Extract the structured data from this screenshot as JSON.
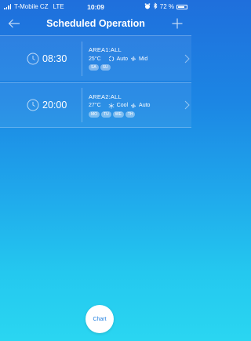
{
  "status_bar": {
    "carrier": "T-Mobile CZ",
    "network": "LTE",
    "time": "10:09",
    "battery": "72 %"
  },
  "nav": {
    "title": "Scheduled Operation",
    "back_icon": "arrow-left-icon",
    "add_icon": "plus-icon"
  },
  "schedules": [
    {
      "time": "08:30",
      "area": "AREA1:ALL",
      "temp": "25°C",
      "mode": "Auto",
      "fan": "Mid",
      "days": [
        "SA",
        "SU"
      ]
    },
    {
      "time": "20:00",
      "area": "AREA2:ALL",
      "temp": "27°C",
      "mode": "Cool",
      "fan": "Auto",
      "days": [
        "MO",
        "TU",
        "WE",
        "TH"
      ]
    }
  ],
  "chart_button": {
    "label": "Chart"
  },
  "colors": {
    "gradient_top": "#1f6fdc",
    "gradient_bottom": "#2ad6f1",
    "chart_text": "#1f7fe0"
  }
}
